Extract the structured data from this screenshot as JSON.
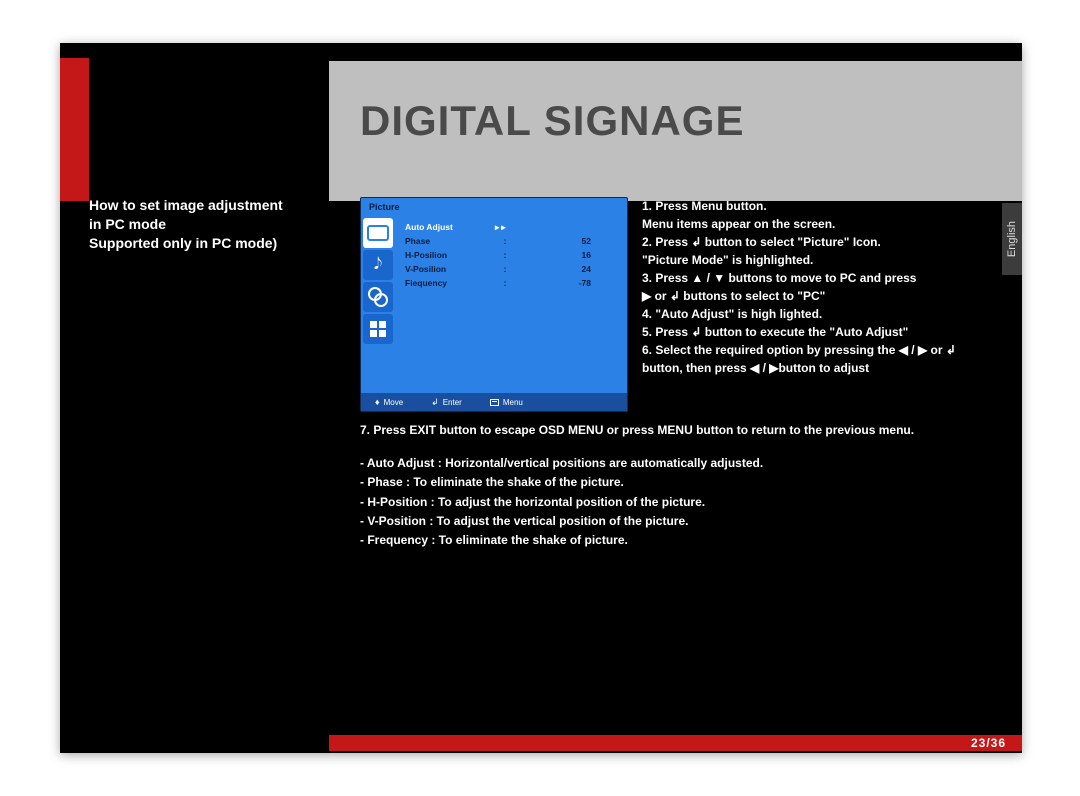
{
  "title": "DIGITAL SIGNAGE",
  "page_number": "23/36",
  "language_tab": "English",
  "sidebar": {
    "line1": "How to set image adjustment",
    "line2": "in PC mode",
    "line3": "Supported only in PC mode)"
  },
  "osd": {
    "title": "Picture",
    "rows": [
      {
        "label": "Auto Adjust",
        "value": "",
        "selected": true,
        "arrows": "▸▸"
      },
      {
        "label": "Phase",
        "value": "52",
        "selected": false
      },
      {
        "label": "H-Posilion",
        "value": "16",
        "selected": false
      },
      {
        "label": "V-Posilion",
        "value": "24",
        "selected": false
      },
      {
        "label": "Fiequency",
        "value": "-78",
        "selected": false
      }
    ],
    "footer": {
      "move": "Move",
      "enter": "Enter",
      "menu": "Menu"
    }
  },
  "instructions": {
    "l1": "1. Press Menu button.",
    "l1b": "    Menu items appear on the screen.",
    "l2": "2. Press ↲ button to select \"Picture\" Icon.",
    "l2b": "    \"Picture Mode\" is highlighted.",
    "l3": "3. Press ▲ / ▼ buttons to move to PC and press",
    "l3b": "    ▶ or ↲ buttons to select to \"PC\"",
    "l4": "4.  \"Auto Adjust\"  is high lighted.",
    "l5": "5. Press ↲ button to execute the \"Auto Adjust\"",
    "l6": "6. Select the required option by pressing the ◀ / ▶ or ↲",
    "l6b": "    button, then press ◀ / ▶button to adjust"
  },
  "continuation": {
    "l7": "7. Press EXIT button to escape OSD MENU or press MENU button to return to the previous menu.",
    "d1": "- Auto Adjust : Horizontal/vertical positions are automatically adjusted.",
    "d2": "- Phase : To eliminate the shake of the picture.",
    "d3": "- H-Position : To adjust the horizontal position of the picture.",
    "d4": "- V-Position  : To adjust the vertical position of the picture.",
    "d5": "- Frequency : To eliminate the shake of picture."
  }
}
